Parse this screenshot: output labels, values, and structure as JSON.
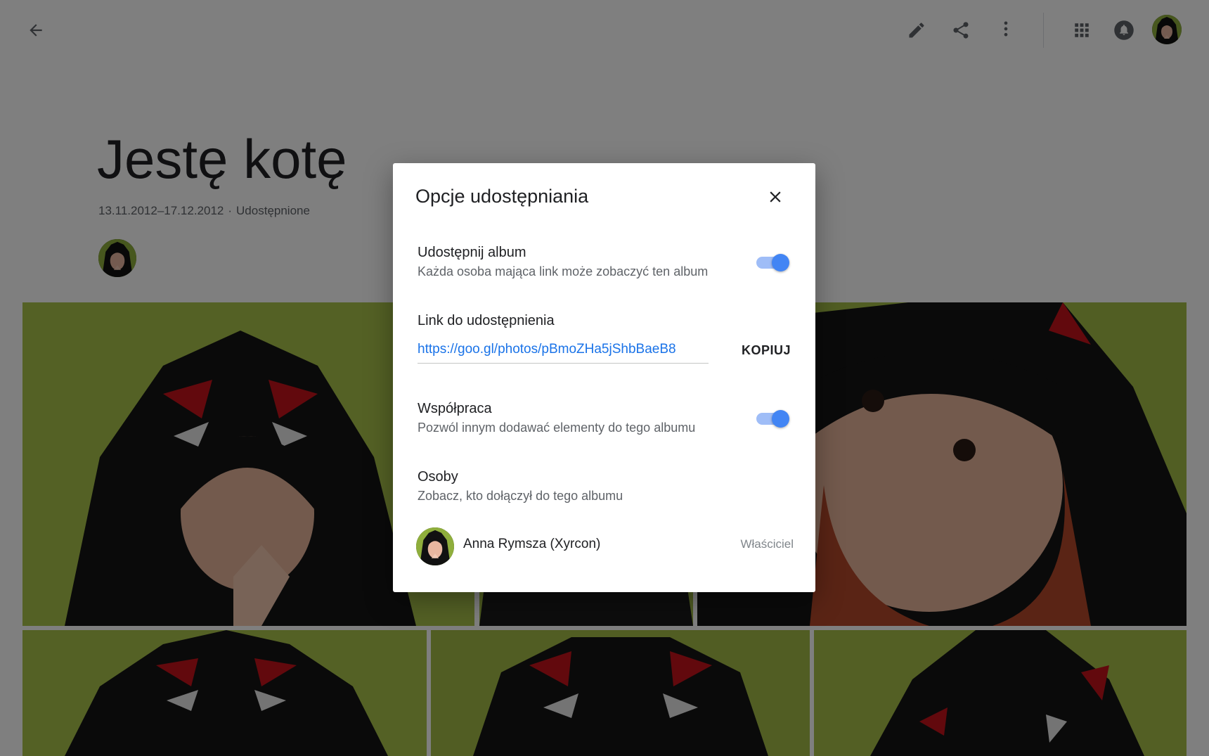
{
  "topbar": {
    "back_icon": "arrow-back-icon",
    "edit_icon": "pencil-icon",
    "share_icon": "share-icon",
    "more_icon": "more-vert-icon",
    "apps_icon": "apps-grid-icon",
    "notifications_icon": "bell-icon"
  },
  "album": {
    "title": "Jestę kotę",
    "date_range": "13.11.2012–17.12.2012",
    "separator": "·",
    "shared_status": "Udostępnione"
  },
  "dialog": {
    "title": "Opcje udostępniania",
    "share_album": {
      "title": "Udostępnij album",
      "subtitle": "Każda osoba mająca link może zobaczyć ten album",
      "enabled": true
    },
    "share_link": {
      "title": "Link do udostępnienia",
      "url": "https://goo.gl/photos/pBmoZHa5jShbBaeB8",
      "copy_label": "KOPIUJ"
    },
    "collaboration": {
      "title": "Współpraca",
      "subtitle": "Pozwól innym dodawać elementy do tego albumu",
      "enabled": true
    },
    "people": {
      "title": "Osoby",
      "subtitle": "Zobacz, kto dołączył do tego albumu",
      "members": [
        {
          "name": "Anna Rymsza (Xyrcon)",
          "role": "Właściciel"
        }
      ]
    }
  },
  "colors": {
    "accent": "#4285f4",
    "toggle_track": "#9fbdf7",
    "link": "#1a73e8",
    "scrim": "rgba(0,0,0,0.5)"
  }
}
